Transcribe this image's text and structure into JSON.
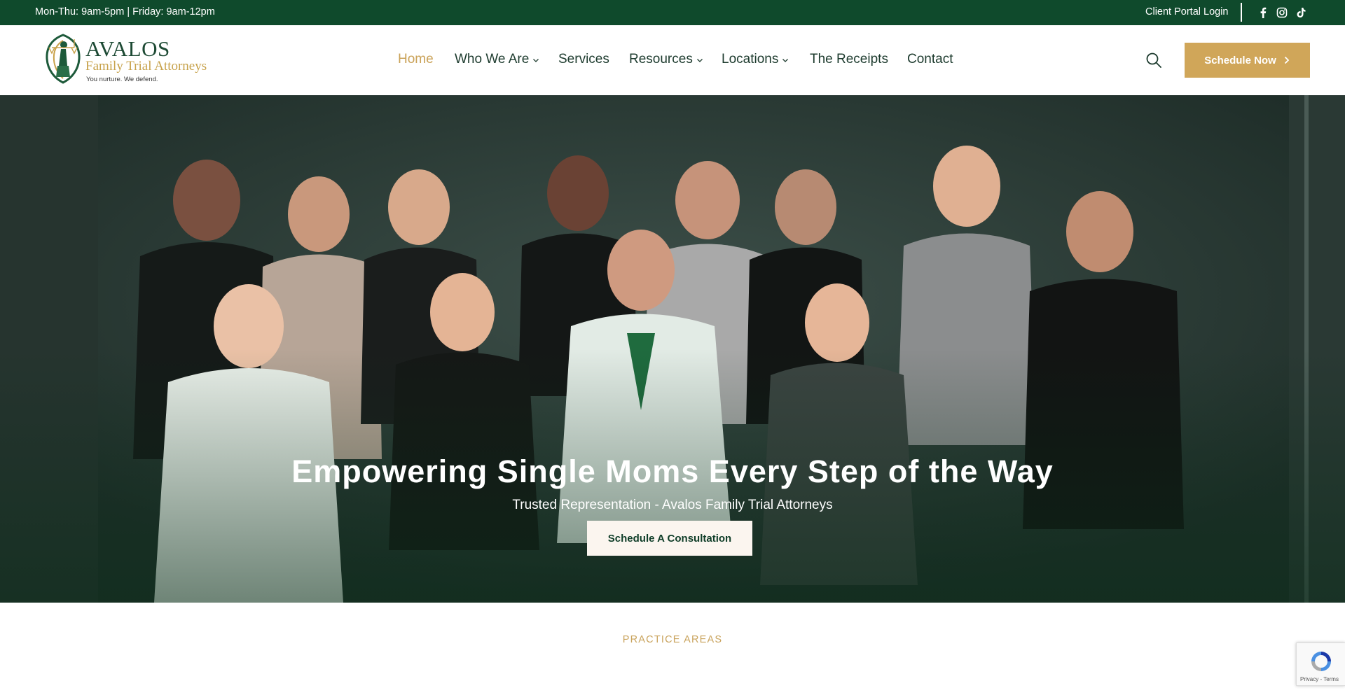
{
  "topbar": {
    "hours": "Mon-Thu: 9am-5pm | Friday: 9am-12pm",
    "portal_label": "Client Portal Login",
    "social": [
      "facebook-icon",
      "instagram-icon",
      "tiktok-icon"
    ]
  },
  "logo": {
    "name": "AVALOS",
    "subtitle": "Family Trial Attorneys",
    "tagline": "You nurture. We defend."
  },
  "nav": {
    "items": [
      {
        "label": "Home",
        "active": true,
        "dropdown": false
      },
      {
        "label": "Who We Are",
        "active": false,
        "dropdown": true
      },
      {
        "label": "Services",
        "active": false,
        "dropdown": false
      },
      {
        "label": "Resources",
        "active": false,
        "dropdown": true
      },
      {
        "label": "Locations",
        "active": false,
        "dropdown": true
      },
      {
        "label": "The Receipts",
        "active": false,
        "dropdown": false
      },
      {
        "label": "Contact",
        "active": false,
        "dropdown": false
      }
    ],
    "schedule_label": "Schedule Now"
  },
  "hero": {
    "title": "Empowering Single Moms Every Step of the Way",
    "subtitle": "Trusted Representation - Avalos Family Trial Attorneys",
    "cta_label": "Schedule A Consultation"
  },
  "section": {
    "eyebrow": "PRACTICE AREAS"
  },
  "recaptcha": {
    "terms": "Privacy - Terms"
  },
  "colors": {
    "brand_green": "#0f4a2c",
    "gold": "#d0a659",
    "nav_text": "#1d3b2e",
    "active_nav": "#caa258"
  }
}
